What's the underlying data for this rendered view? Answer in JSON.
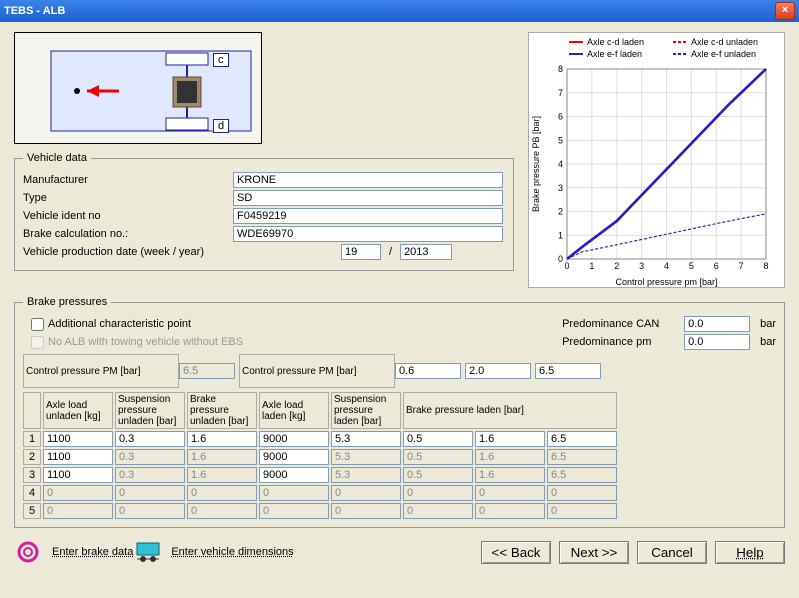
{
  "window": {
    "title": "TEBS - ALB"
  },
  "diagram": {
    "label_top": "c",
    "label_bottom": "d"
  },
  "chart_data": {
    "type": "line",
    "title": "",
    "xlabel": "Control pressure pm [bar]",
    "ylabel": "Brake pressure PB [bar]",
    "xlim": [
      0,
      8
    ],
    "ylim": [
      0,
      8
    ],
    "x": [
      0,
      0.6,
      2.0,
      6.5,
      8.0
    ],
    "series": [
      {
        "name": "Axle c-d laden",
        "style": "solid",
        "color": "#f00000",
        "values": [
          0,
          0.5,
          1.6,
          6.5,
          8.0
        ]
      },
      {
        "name": "Axle c-d unladen",
        "style": "dashed",
        "color": "#f00000",
        "values": [
          0,
          0.3,
          0.6,
          1.6,
          1.9
        ]
      },
      {
        "name": "Axle e-f laden",
        "style": "solid",
        "color": "#2020d0",
        "values": [
          0,
          0.5,
          1.6,
          6.5,
          8.0
        ]
      },
      {
        "name": "Axle e-f unladen",
        "style": "dashed",
        "color": "#2020d0",
        "values": [
          0,
          0.3,
          0.6,
          1.6,
          1.9
        ]
      }
    ],
    "legend_items": [
      "Axle c-d laden",
      "Axle c-d unladen",
      "Axle e-f laden",
      "Axle e-f unladen"
    ]
  },
  "vehicle_data": {
    "legend": "Vehicle data",
    "manufacturer_label": "Manufacturer",
    "manufacturer": "KRONE",
    "type_label": "Type",
    "type": "SD",
    "ident_label": "Vehicle ident no",
    "ident": "F0459219",
    "brake_calc_label": "Brake calculation no.:",
    "brake_calc": "WDE69970",
    "prod_date_label": "Vehicle production date (week / year)",
    "week": "19",
    "slash": "/",
    "year": "2013"
  },
  "brake": {
    "legend": "Brake pressures",
    "addl_label": "Additional characteristic point",
    "noalb_label": "No ALB with towing vehicle without EBS",
    "pre_can_label": "Predominance CAN",
    "pre_can": "0.0",
    "pre_pm_label": "Predominance pm",
    "pre_pm": "0.0",
    "unit_bar": "bar",
    "ctrl_pm_label1": "Control pressure PM [bar]",
    "ctrl_pm_val1": "6.5",
    "ctrl_pm_label2": "Control pressure PM [bar]",
    "ctrl_pm_vals": [
      "0.6",
      "2.0",
      "6.5"
    ],
    "headers": [
      "Axle load unladen [kg]",
      "Suspension pressure unladen [bar]",
      "Brake pressure unladen [bar]",
      "Axle load laden [kg]",
      "Suspension pressure laden [bar]",
      "Brake pressure laden [bar]",
      "",
      ""
    ],
    "rows": [
      {
        "n": "1",
        "v": [
          "1100",
          "0.3",
          "1.6",
          "9000",
          "5.3",
          "0.5",
          "1.6",
          "6.5"
        ],
        "enabled": true
      },
      {
        "n": "2",
        "v": [
          "1100",
          "0.3",
          "1.6",
          "9000",
          "5.3",
          "0.5",
          "1.6",
          "6.5"
        ],
        "enabled": false,
        "first_enabled": true
      },
      {
        "n": "3",
        "v": [
          "1100",
          "0.3",
          "1.6",
          "9000",
          "5.3",
          "0.5",
          "1.6",
          "6.5"
        ],
        "enabled": false,
        "first_enabled": true
      },
      {
        "n": "4",
        "v": [
          "0",
          "0",
          "0",
          "0",
          "0",
          "0",
          "0",
          "0"
        ],
        "enabled": false
      },
      {
        "n": "5",
        "v": [
          "0",
          "0",
          "0",
          "0",
          "0",
          "0",
          "0",
          "0"
        ],
        "enabled": false
      }
    ]
  },
  "buttons": {
    "enter_brake": "Enter brake data",
    "enter_vehicle": "Enter vehicle dimensions",
    "back": "<< Back",
    "next": "Next >>",
    "cancel": "Cancel",
    "help": "Help"
  }
}
